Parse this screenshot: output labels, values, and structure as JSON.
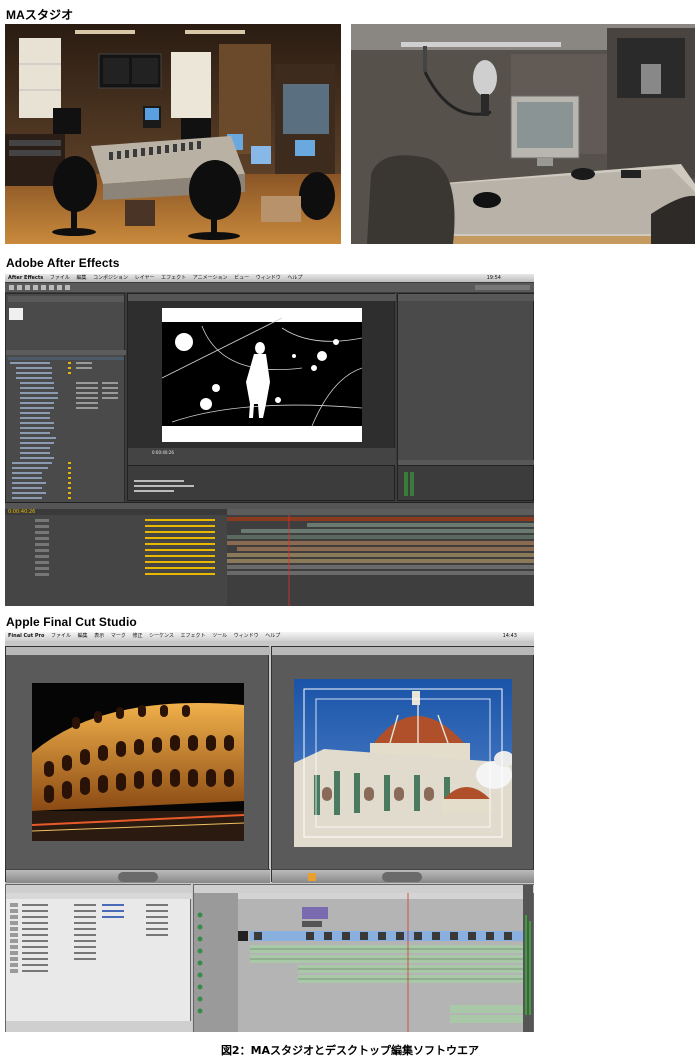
{
  "headings": {
    "ma_studio": "MAスタジオ",
    "after_effects": "Adobe After Effects",
    "final_cut": "Apple Final Cut Studio"
  },
  "caption": "図2：MAスタジオとデスクトップ編集ソフトウエア",
  "after_effects_ui": {
    "menu": [
      "After Effects",
      "ファイル",
      "編集",
      "コンポジション",
      "レイヤー",
      "エフェクト",
      "アニメーション",
      "ビュー",
      "ウィンドウ",
      "ヘルプ"
    ],
    "clock": "19:54",
    "timecode": "0:00:40:26"
  },
  "final_cut_ui": {
    "menu": [
      "Final Cut Pro",
      "ファイル",
      "編集",
      "表示",
      "マーク",
      "修正",
      "シーケンス",
      "エフェクト",
      "ツール",
      "ウィンドウ",
      "ヘルプ"
    ],
    "clock": "14:43"
  },
  "colors": {
    "ae_bg": "#3c3c3c",
    "ae_timecode": "#e8b800",
    "fcp_bg": "#c8c8c8",
    "sky": "#1f5fb0"
  }
}
